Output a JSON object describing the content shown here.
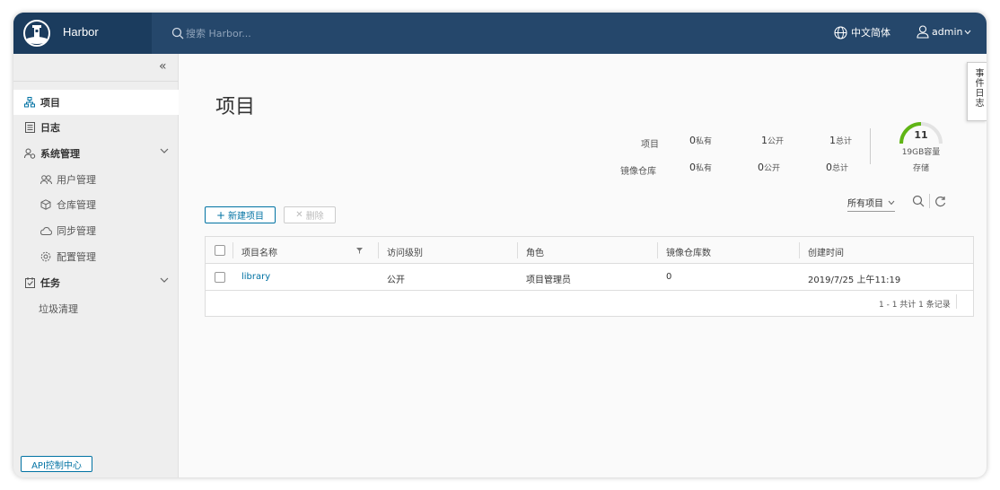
{
  "header": {
    "brand": "Harbor",
    "search_placeholder": "搜索 Harbor...",
    "language": "中文简体",
    "user": "admin"
  },
  "sidebar": {
    "items": [
      {
        "label": "项目",
        "icon": "project-icon",
        "active": true
      },
      {
        "label": "日志",
        "icon": "log-icon"
      },
      {
        "label": "系统管理",
        "icon": "admin-icon",
        "expandable": true
      },
      {
        "label": "用户管理",
        "icon": "users-icon",
        "sub": true
      },
      {
        "label": "仓库管理",
        "icon": "registry-icon",
        "sub": true
      },
      {
        "label": "同步管理",
        "icon": "replication-icon",
        "sub": true
      },
      {
        "label": "配置管理",
        "icon": "config-icon",
        "sub": true
      },
      {
        "label": "任务",
        "icon": "tasks-icon",
        "expandable": true
      },
      {
        "label": "垃圾清理",
        "sub": true
      }
    ],
    "api_button": "API控制中心"
  },
  "main": {
    "title": "项目",
    "stats": {
      "projects_label": "项目",
      "repos_label": "镜像仓库",
      "projects": {
        "private": "0",
        "public": "1",
        "total": "1"
      },
      "repos": {
        "private": "0",
        "public": "0",
        "total": "0"
      },
      "private_unit": "私有",
      "public_unit": "公开",
      "total_unit": "总计"
    },
    "storage": {
      "value": "11",
      "capacity": "19GB容量",
      "label": "存储"
    },
    "new_button": "新建项目",
    "delete_button": "删除",
    "filter": "所有项目",
    "table": {
      "columns": [
        "项目名称",
        "访问级别",
        "角色",
        "镜像仓库数",
        "创建时间"
      ],
      "rows": [
        {
          "name": "library",
          "access": "公开",
          "role": "项目管理员",
          "repos": "0",
          "created": "2019/7/25 上午11:19"
        }
      ],
      "footer": "1 - 1 共计 1 条记录"
    }
  },
  "side_tab": "事件日志",
  "colors": {
    "header": "#25476b",
    "brand_bg": "#1b3c5e",
    "accent": "#0072a3",
    "gauge": "#60b515"
  }
}
